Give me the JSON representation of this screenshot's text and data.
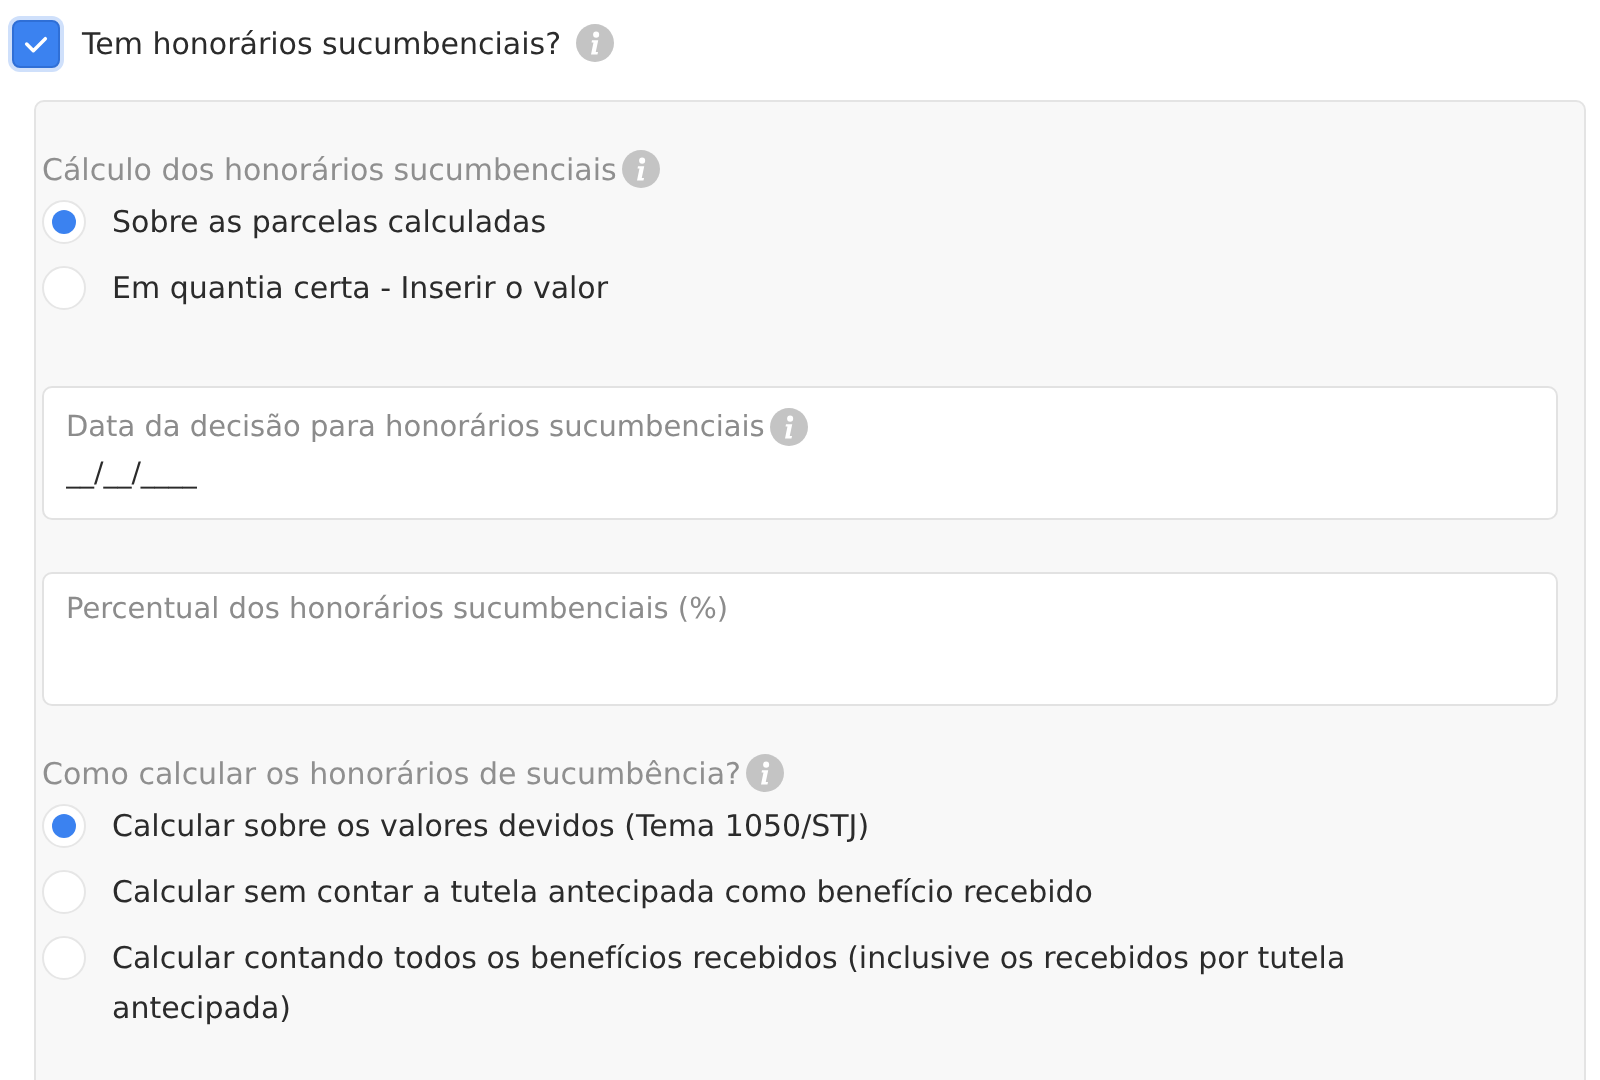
{
  "main_checkbox": {
    "label": "Tem honorários sucumbenciais?",
    "checked": true
  },
  "calculation": {
    "label": "Cálculo dos honorários sucumbenciais",
    "options": [
      {
        "label": "Sobre as parcelas calculadas",
        "selected": true
      },
      {
        "label": "Em quantia certa - Inserir o valor",
        "selected": false
      }
    ]
  },
  "fields": [
    {
      "label": "Data da decisão para honorários sucumbenciais",
      "info": true,
      "value": "__/__/____"
    },
    {
      "label": "Percentual dos honorários sucumbenciais (%)",
      "info": false
    }
  ],
  "method": {
    "label": "Como calcular os honorários de sucumbência?",
    "options": [
      {
        "label": "Calcular sobre os valores devidos (Tema 1050/STJ)",
        "selected": true
      },
      {
        "label": "Calcular sem contar a tutela antecipada como benefício recebido",
        "selected": false
      },
      {
        "label": "Calcular contando todos os benefícios recebidos (inclusive os recebidos por tutela antecipada)",
        "selected": false
      }
    ]
  }
}
